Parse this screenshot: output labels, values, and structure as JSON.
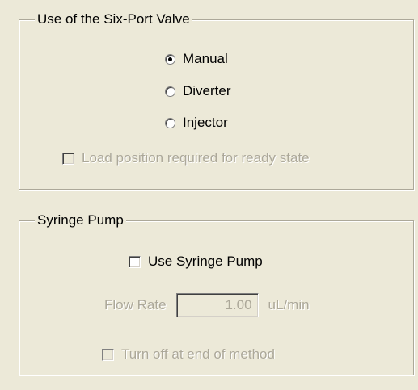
{
  "valve_group": {
    "title": "Use of the Six-Port Valve",
    "options": [
      {
        "label": "Manual",
        "selected": true
      },
      {
        "label": "Diverter",
        "selected": false
      },
      {
        "label": "Injector",
        "selected": false
      }
    ],
    "load_position_label": "Load position required for ready state",
    "load_position_checked": false,
    "load_position_enabled": false
  },
  "syringe_group": {
    "title": "Syringe Pump",
    "use_label": "Use Syringe Pump",
    "use_checked": false,
    "flow_rate_label": "Flow Rate",
    "flow_rate_value": "1.00",
    "flow_rate_unit": "uL/min",
    "turn_off_label": "Turn off at end of method",
    "turn_off_checked": false,
    "turn_off_enabled": false
  }
}
